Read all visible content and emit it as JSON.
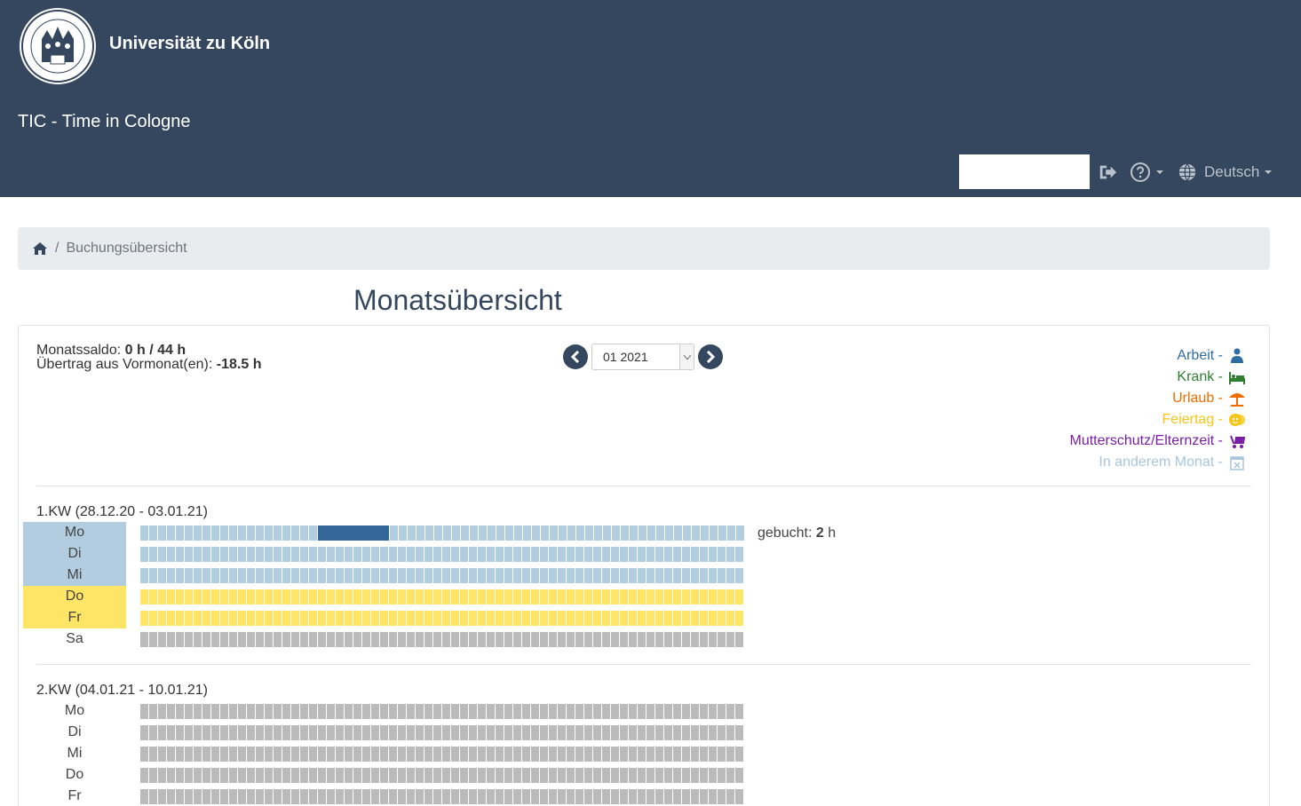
{
  "header": {
    "university": "Universität zu Köln",
    "app_title": "TIC - Time in Cologne",
    "search_value": "",
    "language": "Deutsch"
  },
  "breadcrumb": {
    "current": "Buchungsübersicht"
  },
  "page_title": "Monatsübersicht",
  "summary": {
    "saldo_label": "Monatssaldo:",
    "saldo_value": "0 h / 44 h",
    "carry_label": "Übertrag aus Vormonat(en):",
    "carry_value": "-18.5 h"
  },
  "month_nav": {
    "selected": "01 2021"
  },
  "legend": [
    {
      "label": "Arbeit -",
      "color": "#2e6da4",
      "icon": "person-icon"
    },
    {
      "label": "Krank -",
      "color": "#2e7d32",
      "icon": "bed-icon"
    },
    {
      "label": "Urlaub -",
      "color": "#ef6c00",
      "icon": "umbrella-icon"
    },
    {
      "label": "Feiertag -",
      "color": "#f5c518",
      "icon": "party-icon"
    },
    {
      "label": "Mutterschutz/Elternzeit -",
      "color": "#7b1fa2",
      "icon": "stroller-icon"
    },
    {
      "label": "In anderem Monat -",
      "color": "#a9c6dd",
      "icon": "calendar-x-icon"
    }
  ],
  "colors": {
    "other_month": "#b3cde0",
    "holiday": "#ffe566",
    "work": "#336699",
    "empty": "#bbbbbb"
  },
  "weeks": [
    {
      "label": "1.KW (28.12.20 - 03.01.21)",
      "days": [
        {
          "name": "Mo",
          "type": "other_month",
          "booked_label": "gebucht:",
          "booked_value": "2",
          "booked_unit": "h"
        },
        {
          "name": "Di",
          "type": "other_month"
        },
        {
          "name": "Mi",
          "type": "other_month"
        },
        {
          "name": "Do",
          "type": "holiday"
        },
        {
          "name": "Fr",
          "type": "holiday"
        },
        {
          "name": "Sa",
          "type": "empty"
        }
      ]
    },
    {
      "label": "2.KW (04.01.21 - 10.01.21)",
      "days": [
        {
          "name": "Mo",
          "type": "empty"
        },
        {
          "name": "Di",
          "type": "empty"
        },
        {
          "name": "Mi",
          "type": "empty"
        },
        {
          "name": "Do",
          "type": "empty"
        },
        {
          "name": "Fr",
          "type": "empty"
        }
      ]
    }
  ]
}
